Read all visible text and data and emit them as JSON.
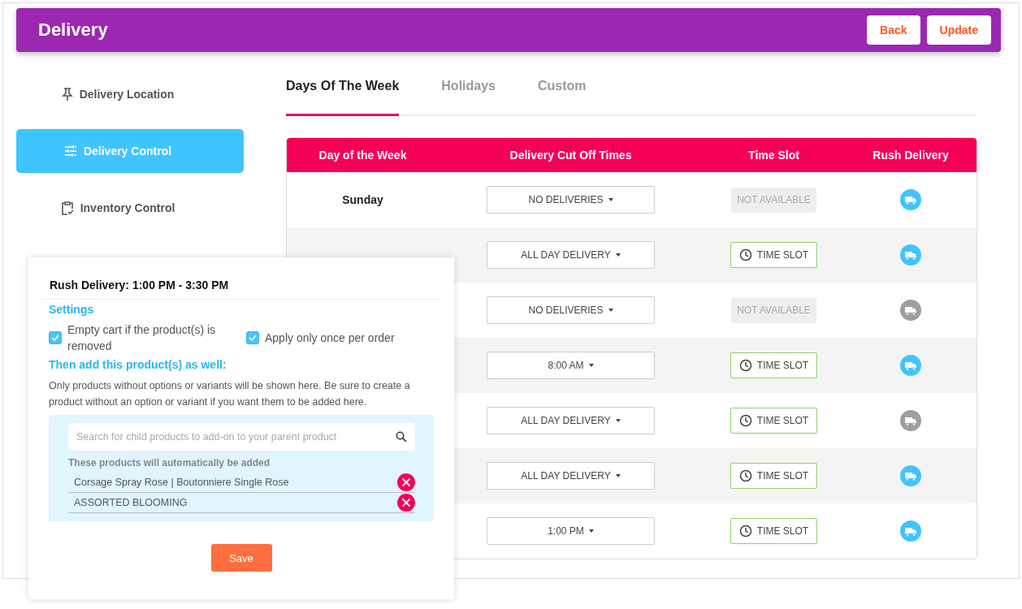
{
  "header": {
    "title": "Delivery",
    "buttons": [
      "Back",
      "Update"
    ]
  },
  "sidebar": {
    "items": [
      {
        "label": "Delivery Location",
        "selected": false
      },
      {
        "label": "Delivery Control",
        "selected": true
      },
      {
        "label": "Inventory Control",
        "selected": false
      }
    ]
  },
  "tabs": [
    {
      "label": "Days Of The Week",
      "selected": true
    },
    {
      "label": "Holidays",
      "selected": false
    },
    {
      "label": "Custom",
      "selected": false
    }
  ],
  "table": {
    "columns": [
      "Day of the Week",
      "Delivery Cut Off Times",
      "Time Slot",
      "Rush Delivery"
    ],
    "rows": [
      {
        "day": "Sunday",
        "cutoff": "NO DELIVERIES",
        "time_slot": {
          "kind": "unavailable",
          "label": "NOT AVAILABLE"
        },
        "rush_active": true
      },
      {
        "cutoff": "ALL DAY DELIVERY",
        "time_slot": {
          "kind": "slot",
          "label": "TIME SLOT"
        },
        "rush_active": true
      },
      {
        "cutoff": "NO DELIVERIES",
        "time_slot": {
          "kind": "unavailable",
          "label": "NOT AVAILABLE"
        },
        "rush_active": false
      },
      {
        "cutoff": "8:00 AM",
        "time_slot": {
          "kind": "slot",
          "label": "TIME SLOT"
        },
        "rush_active": true
      },
      {
        "cutoff": "ALL DAY DELIVERY",
        "time_slot": {
          "kind": "slot",
          "label": "TIME SLOT"
        },
        "rush_active": false
      },
      {
        "cutoff": "ALL DAY DELIVERY",
        "time_slot": {
          "kind": "slot",
          "label": "TIME SLOT"
        },
        "rush_active": true
      },
      {
        "cutoff": "1:00 PM",
        "time_slot": {
          "kind": "slot",
          "label": "TIME SLOT"
        },
        "rush_active": true
      }
    ]
  },
  "popup": {
    "title": "Rush Delivery: 1:00 PM - 3:30 PM",
    "settings_heading": "Settings",
    "options": [
      {
        "label": "Empty cart if the product(s) is removed",
        "checked": true
      },
      {
        "label": "Apply only once per order",
        "checked": true
      }
    ],
    "add_heading": "Then add this product(s) as well:",
    "note": "Only products without options or variants will be shown here. Be sure to create a product without an option or variant if you want them to be added here.",
    "search": {
      "placeholder": "Search for child products to add-on to your parent product"
    },
    "added_label": "These products will automatically be added",
    "products": [
      "Corsage Spray Rose |  Boutonniere Single Rose",
      "ASSORTED BLOOMING"
    ],
    "save_button": "Save"
  }
}
